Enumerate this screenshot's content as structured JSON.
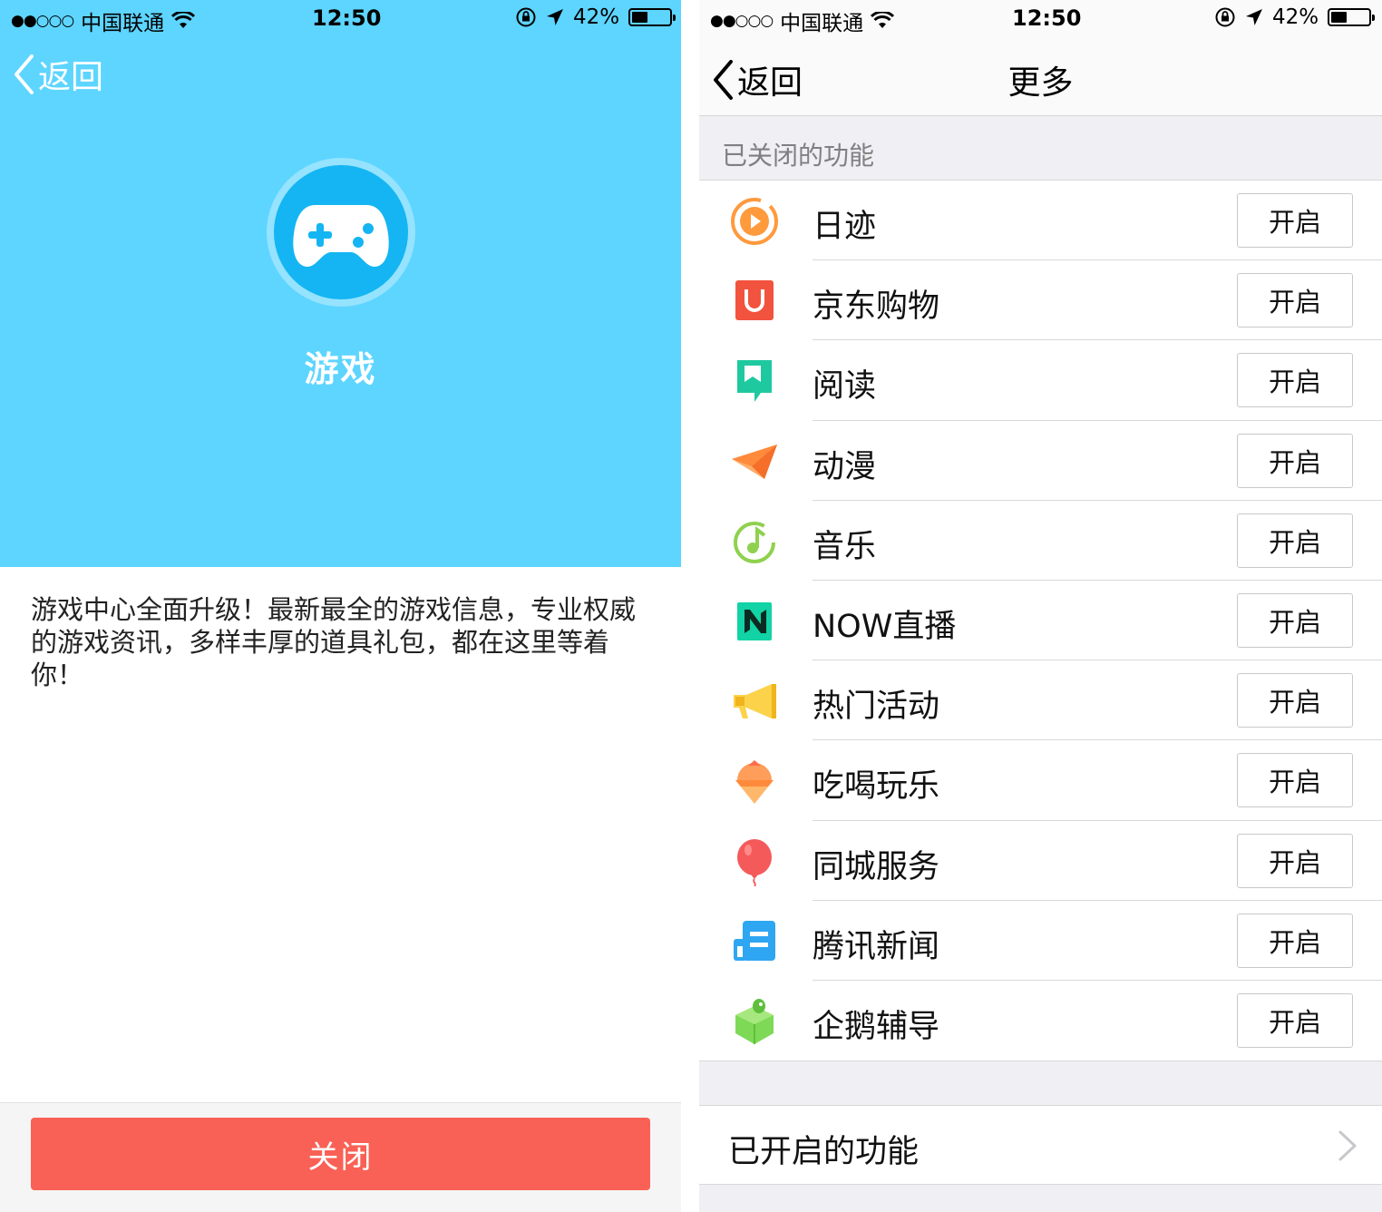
{
  "status_bar": {
    "signal": "●●○○○",
    "carrier": "中国联通",
    "time": "12:50",
    "battery_text": "42%",
    "battery_level": 0.42
  },
  "left_screen": {
    "back_label": "返回",
    "feature_icon": "gamepad-icon",
    "feature_title": "游戏",
    "description": "游戏中心全面升级！最新最全的游戏信息，专业权威的游戏资讯，多样丰厚的道具礼包，都在这里等着你！",
    "close_button": "关闭",
    "colors": {
      "hero": "#5dd5ff",
      "icon_disc": "#14b5f2",
      "close_button": "#fa6156"
    }
  },
  "right_screen": {
    "back_label": "返回",
    "title": "更多",
    "closed_section_header": "已关闭的功能",
    "items": [
      {
        "label": "日迹",
        "icon": "record-icon",
        "button": "开启"
      },
      {
        "label": "京东购物",
        "icon": "jd-shopping-icon",
        "button": "开启"
      },
      {
        "label": "阅读",
        "icon": "reading-icon",
        "button": "开启"
      },
      {
        "label": "动漫",
        "icon": "paper-plane-icon",
        "button": "开启"
      },
      {
        "label": "音乐",
        "icon": "music-note-icon",
        "button": "开启"
      },
      {
        "label": "NOW直播",
        "icon": "now-live-icon",
        "button": "开启"
      },
      {
        "label": "热门活动",
        "icon": "megaphone-icon",
        "button": "开启"
      },
      {
        "label": "吃喝玩乐",
        "icon": "ice-cream-icon",
        "button": "开启"
      },
      {
        "label": "同城服务",
        "icon": "balloon-icon",
        "button": "开启"
      },
      {
        "label": "腾讯新闻",
        "icon": "news-icon",
        "button": "开启"
      },
      {
        "label": "企鹅辅导",
        "icon": "penguin-tutor-icon",
        "button": "开启"
      }
    ],
    "enabled_section": "已开启的功能"
  }
}
